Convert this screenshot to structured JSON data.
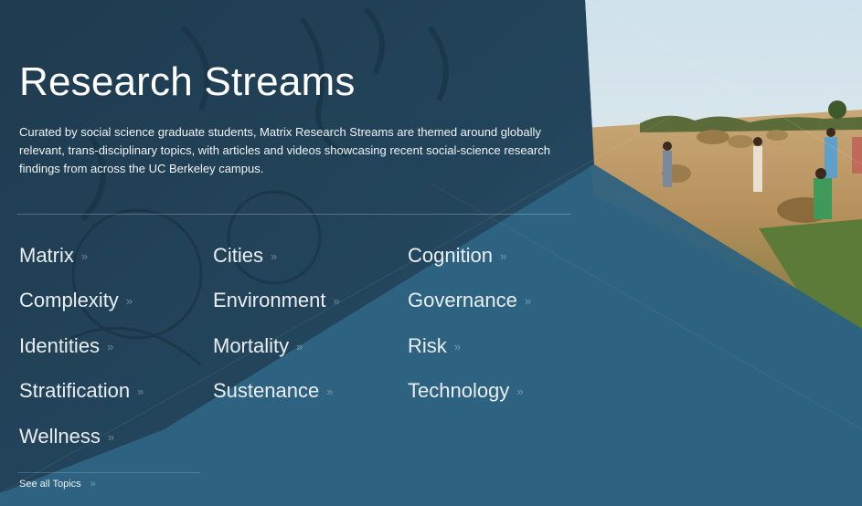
{
  "hero": {
    "title": "Research Streams",
    "description": "Curated by social science graduate students, Matrix Research Streams are themed around globally relevant, trans-disciplinary topics, with articles and videos showcasing recent social-science research findings from across the UC Berkeley campus."
  },
  "topics": [
    {
      "label": "Matrix",
      "arrow": "»"
    },
    {
      "label": "Cities",
      "arrow": "»"
    },
    {
      "label": "Cognition",
      "arrow": "»"
    },
    {
      "label": "Complexity",
      "arrow": "»"
    },
    {
      "label": "Environment",
      "arrow": "»"
    },
    {
      "label": "Governance",
      "arrow": "»"
    },
    {
      "label": "Identities",
      "arrow": "»"
    },
    {
      "label": "Mortality",
      "arrow": "»"
    },
    {
      "label": "Risk",
      "arrow": "»"
    },
    {
      "label": "Stratification",
      "arrow": "»"
    },
    {
      "label": "Sustenance",
      "arrow": "»"
    },
    {
      "label": "Technology",
      "arrow": "»"
    },
    {
      "label": "Wellness",
      "arrow": "»"
    }
  ],
  "see_all": {
    "label": "See all Topics",
    "arrow": "»"
  },
  "colors": {
    "panel": "#2d6281",
    "text": "#ffffff"
  }
}
